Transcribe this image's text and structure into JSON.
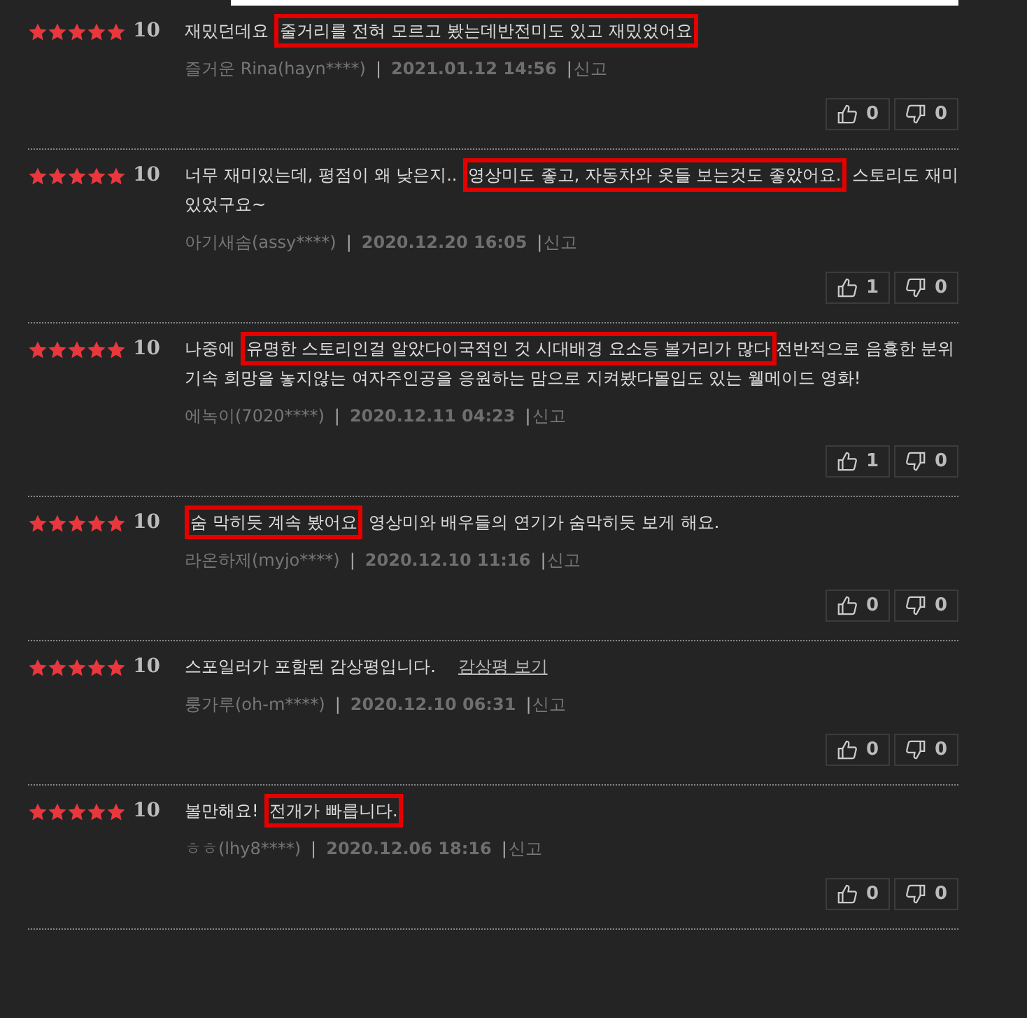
{
  "reviews": [
    {
      "stars": 5,
      "score": "10",
      "text": [
        {
          "text": "재밌던데요 ",
          "highlighted": false
        },
        {
          "text": "줄거리를 전혀 모르고 봤는데반전미도 있고 재밌었어요",
          "highlighted": true
        }
      ],
      "author": "즐거운 Rina(hayn****)",
      "sep_1": "|",
      "date": "2021.01.12 14:56",
      "sep_2": "|",
      "report": "신고",
      "likes": "0",
      "dislikes": "0"
    },
    {
      "stars": 5,
      "score": "10",
      "text": [
        {
          "text": "너무 재미있는데, 평점이 왜 낮은지.. ",
          "highlighted": false
        },
        {
          "text": "영상미도 좋고, 자동차와 옷들 보는것도 좋았어요.",
          "highlighted": true
        },
        {
          "text": " 스토리도 재미있었구요~",
          "highlighted": false
        }
      ],
      "author": "아기새솜(assy****)",
      "sep_1": "|",
      "date": "2020.12.20 16:05",
      "sep_2": "|",
      "report": "신고",
      "likes": "1",
      "dislikes": "0"
    },
    {
      "stars": 5,
      "score": "10",
      "text": [
        {
          "text": "나중에 ",
          "highlighted": false
        },
        {
          "text": "유명한 스토리인걸 알았다이국적인 것 시대배경 요소등 볼거리가 많다",
          "highlighted": true
        },
        {
          "text": "전반적으로 음흉한 분위기속 희망을 놓지않는 여자주인공을 응원하는 맘으로 지켜봤다몰입도 있는 웰메이드 영화!",
          "highlighted": false
        }
      ],
      "author": "에녹이(7020****)",
      "sep_1": "|",
      "date": "2020.12.11 04:23",
      "sep_2": "|",
      "report": "신고",
      "likes": "1",
      "dislikes": "0"
    },
    {
      "stars": 5,
      "score": "10",
      "text": [
        {
          "text": "숨 막히듯 계속 봤어요",
          "highlighted": true
        },
        {
          "text": " 영상미와 배우들의 연기가 숨막히듯 보게 해요.",
          "highlighted": false
        }
      ],
      "author": "라온하제(myjo****)",
      "sep_1": "|",
      "date": "2020.12.10 11:16",
      "sep_2": "|",
      "report": "신고",
      "likes": "0",
      "dislikes": "0"
    },
    {
      "stars": 5,
      "score": "10",
      "text": [
        {
          "text": "스포일러가 포함된 감상평입니다.",
          "highlighted": false
        }
      ],
      "spoiler_link": "감상평 보기",
      "author": "룽가루(oh-m****)",
      "sep_1": "|",
      "date": "2020.12.10 06:31",
      "sep_2": "|",
      "report": "신고",
      "likes": "0",
      "dislikes": "0"
    },
    {
      "stars": 5,
      "score": "10",
      "text": [
        {
          "text": "볼만해요! ",
          "highlighted": false
        },
        {
          "text": "전개가 빠릅니다.",
          "highlighted": true
        }
      ],
      "author": "ㅎㅎ(lhy8****)",
      "sep_1": "|",
      "date": "2020.12.06 18:16",
      "sep_2": "|",
      "report": "신고",
      "likes": "0",
      "dislikes": "0"
    }
  ]
}
